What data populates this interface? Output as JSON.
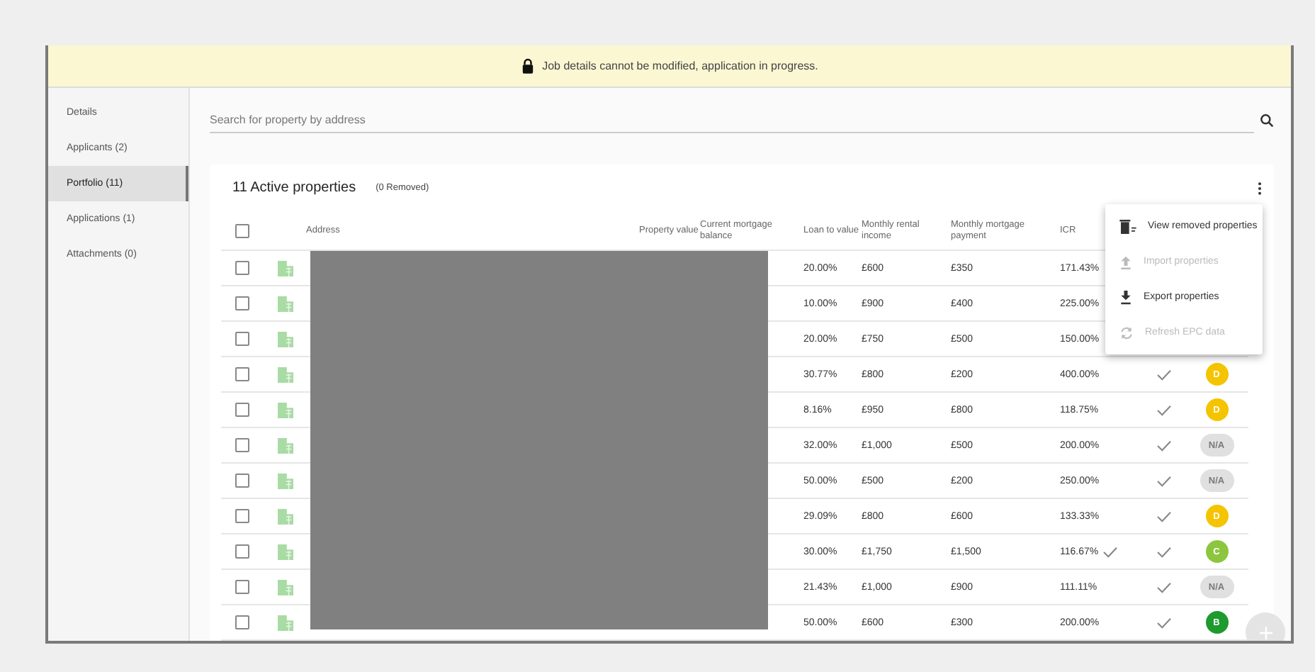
{
  "banner": {
    "text": "Job details cannot be modified, application in progress."
  },
  "sidebar": {
    "items": [
      {
        "label": "Details",
        "selected": false
      },
      {
        "label": "Applicants (2)",
        "selected": false
      },
      {
        "label": "Portfolio (11)",
        "selected": true
      },
      {
        "label": "Applications (1)",
        "selected": false
      },
      {
        "label": "Attachments (0)",
        "selected": false
      }
    ]
  },
  "search": {
    "placeholder": "Search for property by address"
  },
  "card": {
    "title": "11 Active properties",
    "removed": "(0 Removed)"
  },
  "table": {
    "select_all": {
      "checked": false
    },
    "columns": [
      "Address",
      "Property value",
      "Current mortgage balance",
      "Loan to value",
      "Monthly rental income",
      "Monthly mortgage payment",
      "ICR"
    ],
    "rows": [
      {
        "checked": false,
        "ltv": "20.00%",
        "rent": "£600",
        "payment": "£350",
        "icr": "171.43%"
      },
      {
        "checked": false,
        "ltv": "10.00%",
        "rent": "£900",
        "payment": "£400",
        "icr": "225.00%"
      },
      {
        "checked": false,
        "ltv": "20.00%",
        "rent": "£750",
        "payment": "£500",
        "icr": "150.00%"
      },
      {
        "checked": false,
        "ltv": "30.77%",
        "rent": "£800",
        "payment": "£200",
        "icr": "400.00%",
        "icr_check": false,
        "check": true,
        "epc": {
          "label": "D",
          "color": "#f5c400"
        }
      },
      {
        "checked": false,
        "ltv": "8.16%",
        "rent": "£950",
        "payment": "£800",
        "icr": "118.75%",
        "icr_check": false,
        "check": true,
        "epc": {
          "label": "D",
          "color": "#f5c400"
        }
      },
      {
        "checked": false,
        "ltv": "32.00%",
        "rent": "£1,000",
        "payment": "£500",
        "icr": "200.00%",
        "icr_check": false,
        "check": true,
        "epc": {
          "label": "N/A",
          "color": "#e0e0e0"
        }
      },
      {
        "checked": false,
        "ltv": "50.00%",
        "rent": "£500",
        "payment": "£200",
        "icr": "250.00%",
        "icr_check": false,
        "check": true,
        "epc": {
          "label": "N/A",
          "color": "#e0e0e0"
        }
      },
      {
        "checked": false,
        "ltv": "29.09%",
        "rent": "£800",
        "payment": "£600",
        "icr": "133.33%",
        "icr_check": false,
        "check": true,
        "epc": {
          "label": "D",
          "color": "#f5c400"
        }
      },
      {
        "checked": false,
        "ltv": "30.00%",
        "rent": "£1,750",
        "payment": "£1,500",
        "icr": "116.67%",
        "icr_check": true,
        "check": true,
        "epc": {
          "label": "C",
          "color": "#8cc63f"
        }
      },
      {
        "checked": false,
        "ltv": "21.43%",
        "rent": "£1,000",
        "payment": "£900",
        "icr": "111.11%",
        "icr_check": false,
        "check": true,
        "epc": {
          "label": "N/A",
          "color": "#e0e0e0"
        }
      },
      {
        "checked": false,
        "ltv": "50.00%",
        "rent": "£600",
        "payment": "£300",
        "icr": "200.00%",
        "icr_check": false,
        "check": true,
        "epc": {
          "label": "B",
          "color": "#1e9a2e"
        }
      }
    ]
  },
  "menu": {
    "items": [
      {
        "kind": "removed",
        "label": "View removed properties",
        "disabled": false
      },
      {
        "kind": "upload",
        "label": "Import properties",
        "disabled": true
      },
      {
        "kind": "download",
        "label": "Export properties",
        "disabled": false
      },
      {
        "kind": "refresh",
        "label": "Refresh EPC data",
        "disabled": true
      }
    ]
  },
  "fab": {
    "disabled": true
  }
}
